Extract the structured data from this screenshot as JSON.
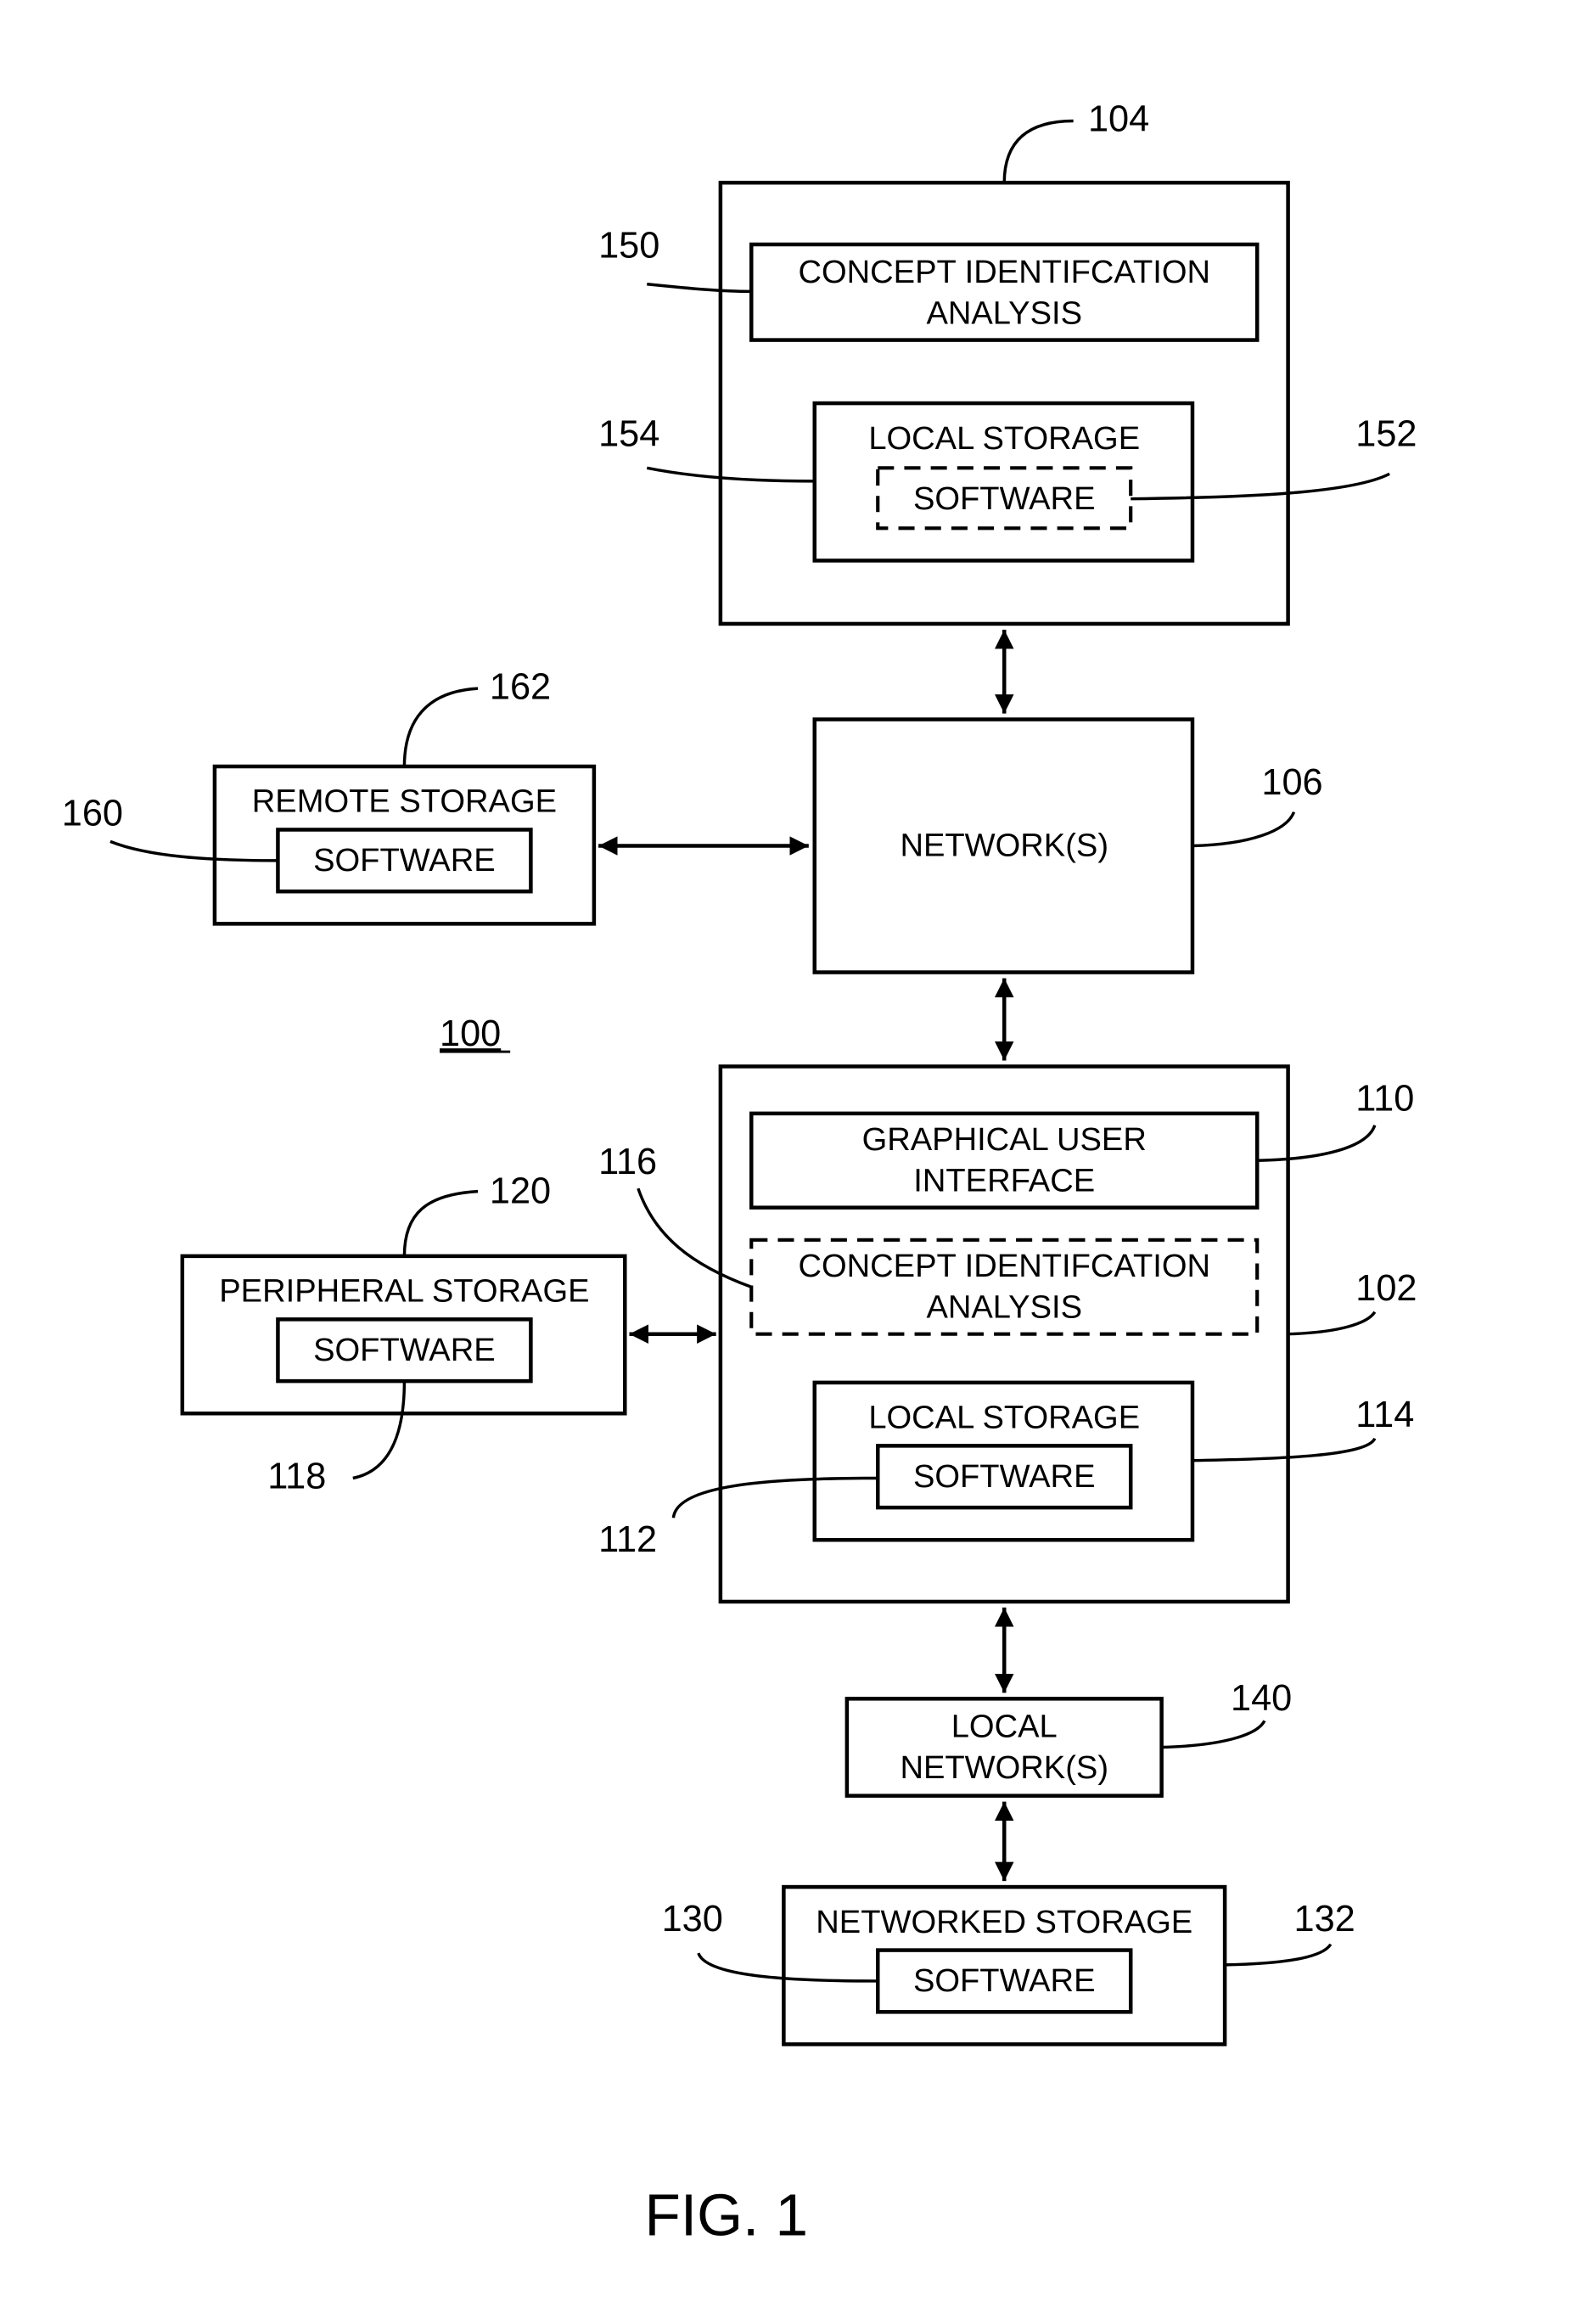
{
  "figure": {
    "caption": "FIG. 1",
    "system_ref": "100"
  },
  "server": {
    "ref": "104",
    "analysis": {
      "ref": "150",
      "line1": "CONCEPT IDENTIFCATION",
      "line2": "ANALYSIS"
    },
    "storage": {
      "ref": "154",
      "label": "LOCAL STORAGE"
    },
    "software": {
      "ref": "152",
      "label": "SOFTWARE"
    }
  },
  "network": {
    "ref": "106",
    "label": "NETWORK(S)"
  },
  "remote_storage": {
    "ref": "162",
    "label": "REMOTE STORAGE",
    "software": {
      "ref": "160",
      "label": "SOFTWARE"
    }
  },
  "client": {
    "ref": "102",
    "gui": {
      "ref": "110",
      "line1": "GRAPHICAL USER",
      "line2": "INTERFACE"
    },
    "analysis": {
      "ref": "116",
      "line1": "CONCEPT IDENTIFCATION",
      "line2": "ANALYSIS"
    },
    "storage": {
      "ref": "114",
      "label": "LOCAL STORAGE"
    },
    "software": {
      "ref": "112",
      "label": "SOFTWARE"
    }
  },
  "peripheral_storage": {
    "ref": "120",
    "label": "PERIPHERAL STORAGE",
    "software": {
      "ref": "118",
      "label": "SOFTWARE"
    }
  },
  "local_network": {
    "ref": "140",
    "line1": "LOCAL",
    "line2": "NETWORK(S)"
  },
  "networked_storage": {
    "ref": "132",
    "label": "NETWORKED STORAGE",
    "software": {
      "ref": "130",
      "label": "SOFTWARE"
    }
  }
}
